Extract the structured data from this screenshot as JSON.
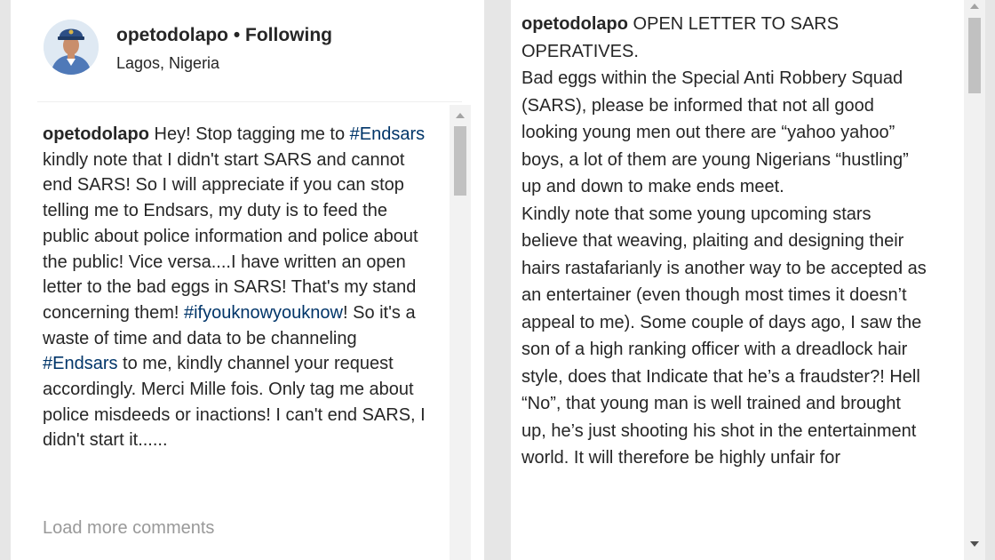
{
  "post_header": {
    "username": "opetodolapo",
    "separator": "•",
    "follow_status": "Following",
    "location": "Lagos, Nigeria"
  },
  "comment": {
    "author": "opetodolapo",
    "text_part1": " Hey! Stop tagging me to ",
    "tag1": "#Endsars",
    "text_part2": " kindly note that I didn't start SARS and cannot end SARS! So I will appreciate if you can stop telling me to Endsars, my duty is to feed the public about police information and police about the public! Vice versa....I have written an open letter to the bad eggs in SARS! That's my stand concerning them! ",
    "tag2": "#ifyouknowyouknow",
    "text_part3": "! So it's a waste of time and data to be channeling ",
    "tag3": "#Endsars",
    "text_part4": " to me, kindly channel your request accordingly. Merci Mille fois. Only tag me about police misdeeds or inactions! I can't end SARS, I didn't start it......"
  },
  "load_more_label": "Load more comments",
  "caption": {
    "author": "opetodolapo",
    "title": " OPEN LETTER TO SARS OPERATIVES.",
    "paragraph1": "Bad eggs within the Special Anti Robbery Squad (SARS), please be informed that not all good looking young men out there are “yahoo yahoo” boys, a lot of them are young Nigerians “hustling” up and down to make ends meet.",
    "paragraph2": "Kindly note that some young upcoming stars believe that weaving, plaiting and designing their hairs rastafarianly is another way to be accepted as an entertainer (even though most times it doesn’t appeal to me). Some couple of days ago, I saw the son of a high ranking officer with a dreadlock hair style, does that Indicate that he’s a fraudster?! Hell “No”, that young man is well trained and brought up, he’s just shooting his shot in the entertainment world. It will therefore be highly unfair for"
  },
  "colors": {
    "text": "#262626",
    "hashtag": "#003569",
    "muted": "#999999"
  },
  "icons": {
    "avatar": "profile-avatar",
    "scroll_up": "triangle-up",
    "scroll_down": "triangle-down"
  }
}
